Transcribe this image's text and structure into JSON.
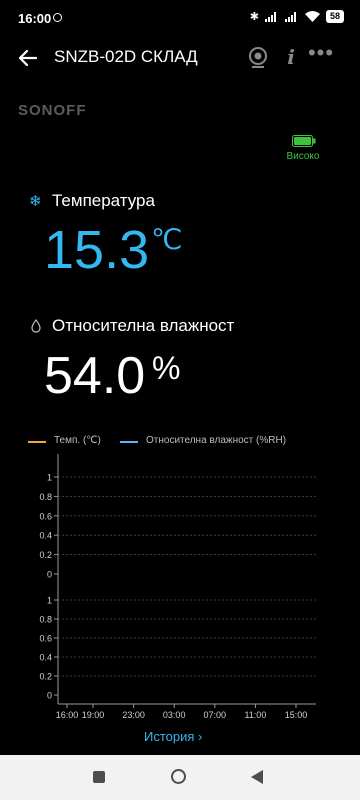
{
  "status_bar": {
    "time": "16:00",
    "bluetooth": "✱",
    "battery": "58",
    "icons": [
      "alarm-ring-icon",
      "bluetooth-icon",
      "signal-icon",
      "signal-icon",
      "wifi-icon",
      "battery-icon"
    ]
  },
  "app_bar": {
    "title": "SNZB-02D СКЛАД",
    "icons": [
      "back-arrow-icon",
      "camera-icon",
      "info-icon",
      "more-icon"
    ]
  },
  "brand": {
    "name": "SONOFF"
  },
  "device_battery": {
    "label": "Високо",
    "color": "#3fc13f",
    "level": 1.0
  },
  "temperature": {
    "label": "Температура",
    "value": "15.3",
    "unit": "℃",
    "icon": "snowflake-icon",
    "color": "#35b7f0"
  },
  "humidity": {
    "label": "Относителна влажност",
    "value": "54.0",
    "unit": "%",
    "icon": "drop-icon"
  },
  "chart_legend": {
    "temp": "Темп.  (℃)",
    "humidity": "Относителна влажност  (%RH)",
    "temp_color": "#f4a83a",
    "humidity_color": "#5fb4f6"
  },
  "chart_data": {
    "type": "line",
    "x_ticks": [
      "16:00",
      "19:00",
      "23:00",
      "03:00",
      "07:00",
      "11:00",
      "15:00"
    ],
    "upper_y_ticks": [
      "1",
      "0.8",
      "0.6",
      "0.4",
      "0.2",
      "0"
    ],
    "lower_y_ticks": [
      "1",
      "0.8",
      "0.6",
      "0.4",
      "0.2",
      "0"
    ],
    "upper_ylim": [
      0,
      1
    ],
    "lower_ylim": [
      0,
      1
    ],
    "series": [
      {
        "values": []
      },
      {
        "values": []
      }
    ],
    "grid": true
  },
  "footer": {
    "history_label": "История ›"
  },
  "nav_bar": {
    "icons": [
      "recent-apps-icon",
      "home-icon",
      "nav-back-icon"
    ]
  }
}
